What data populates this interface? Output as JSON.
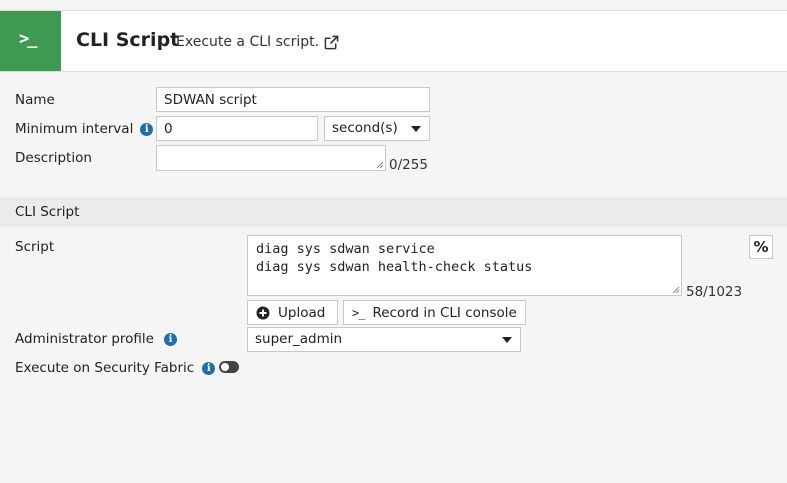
{
  "header": {
    "icon": "terminal-icon",
    "icon_glyph": ">_",
    "title": "CLI Script",
    "subtitle": "Execute a CLI script."
  },
  "form": {
    "name_label": "Name",
    "name_value": "SDWAN script",
    "min_interval_label": "Minimum interval",
    "min_interval_value": "0",
    "min_interval_unit": "second(s)",
    "description_label": "Description",
    "description_value": "",
    "description_counter": "0/255"
  },
  "cli_section": {
    "title": "CLI Script",
    "script_label": "Script",
    "script_lines": "diag sys sdwan service\ndiag sys sdwan health-check status",
    "script_counter": "58/1023",
    "percent_label": "%",
    "upload_label": "Upload",
    "record_label": "Record in CLI console",
    "record_glyph": ">_",
    "admin_profile_label": "Administrator profile",
    "admin_profile_value": "super_admin",
    "security_fabric_label": "Execute on Security Fabric",
    "security_fabric_enabled": false
  },
  "colors": {
    "header_icon_bg": "#3d9a50",
    "info_icon": "#1f6fa8"
  }
}
